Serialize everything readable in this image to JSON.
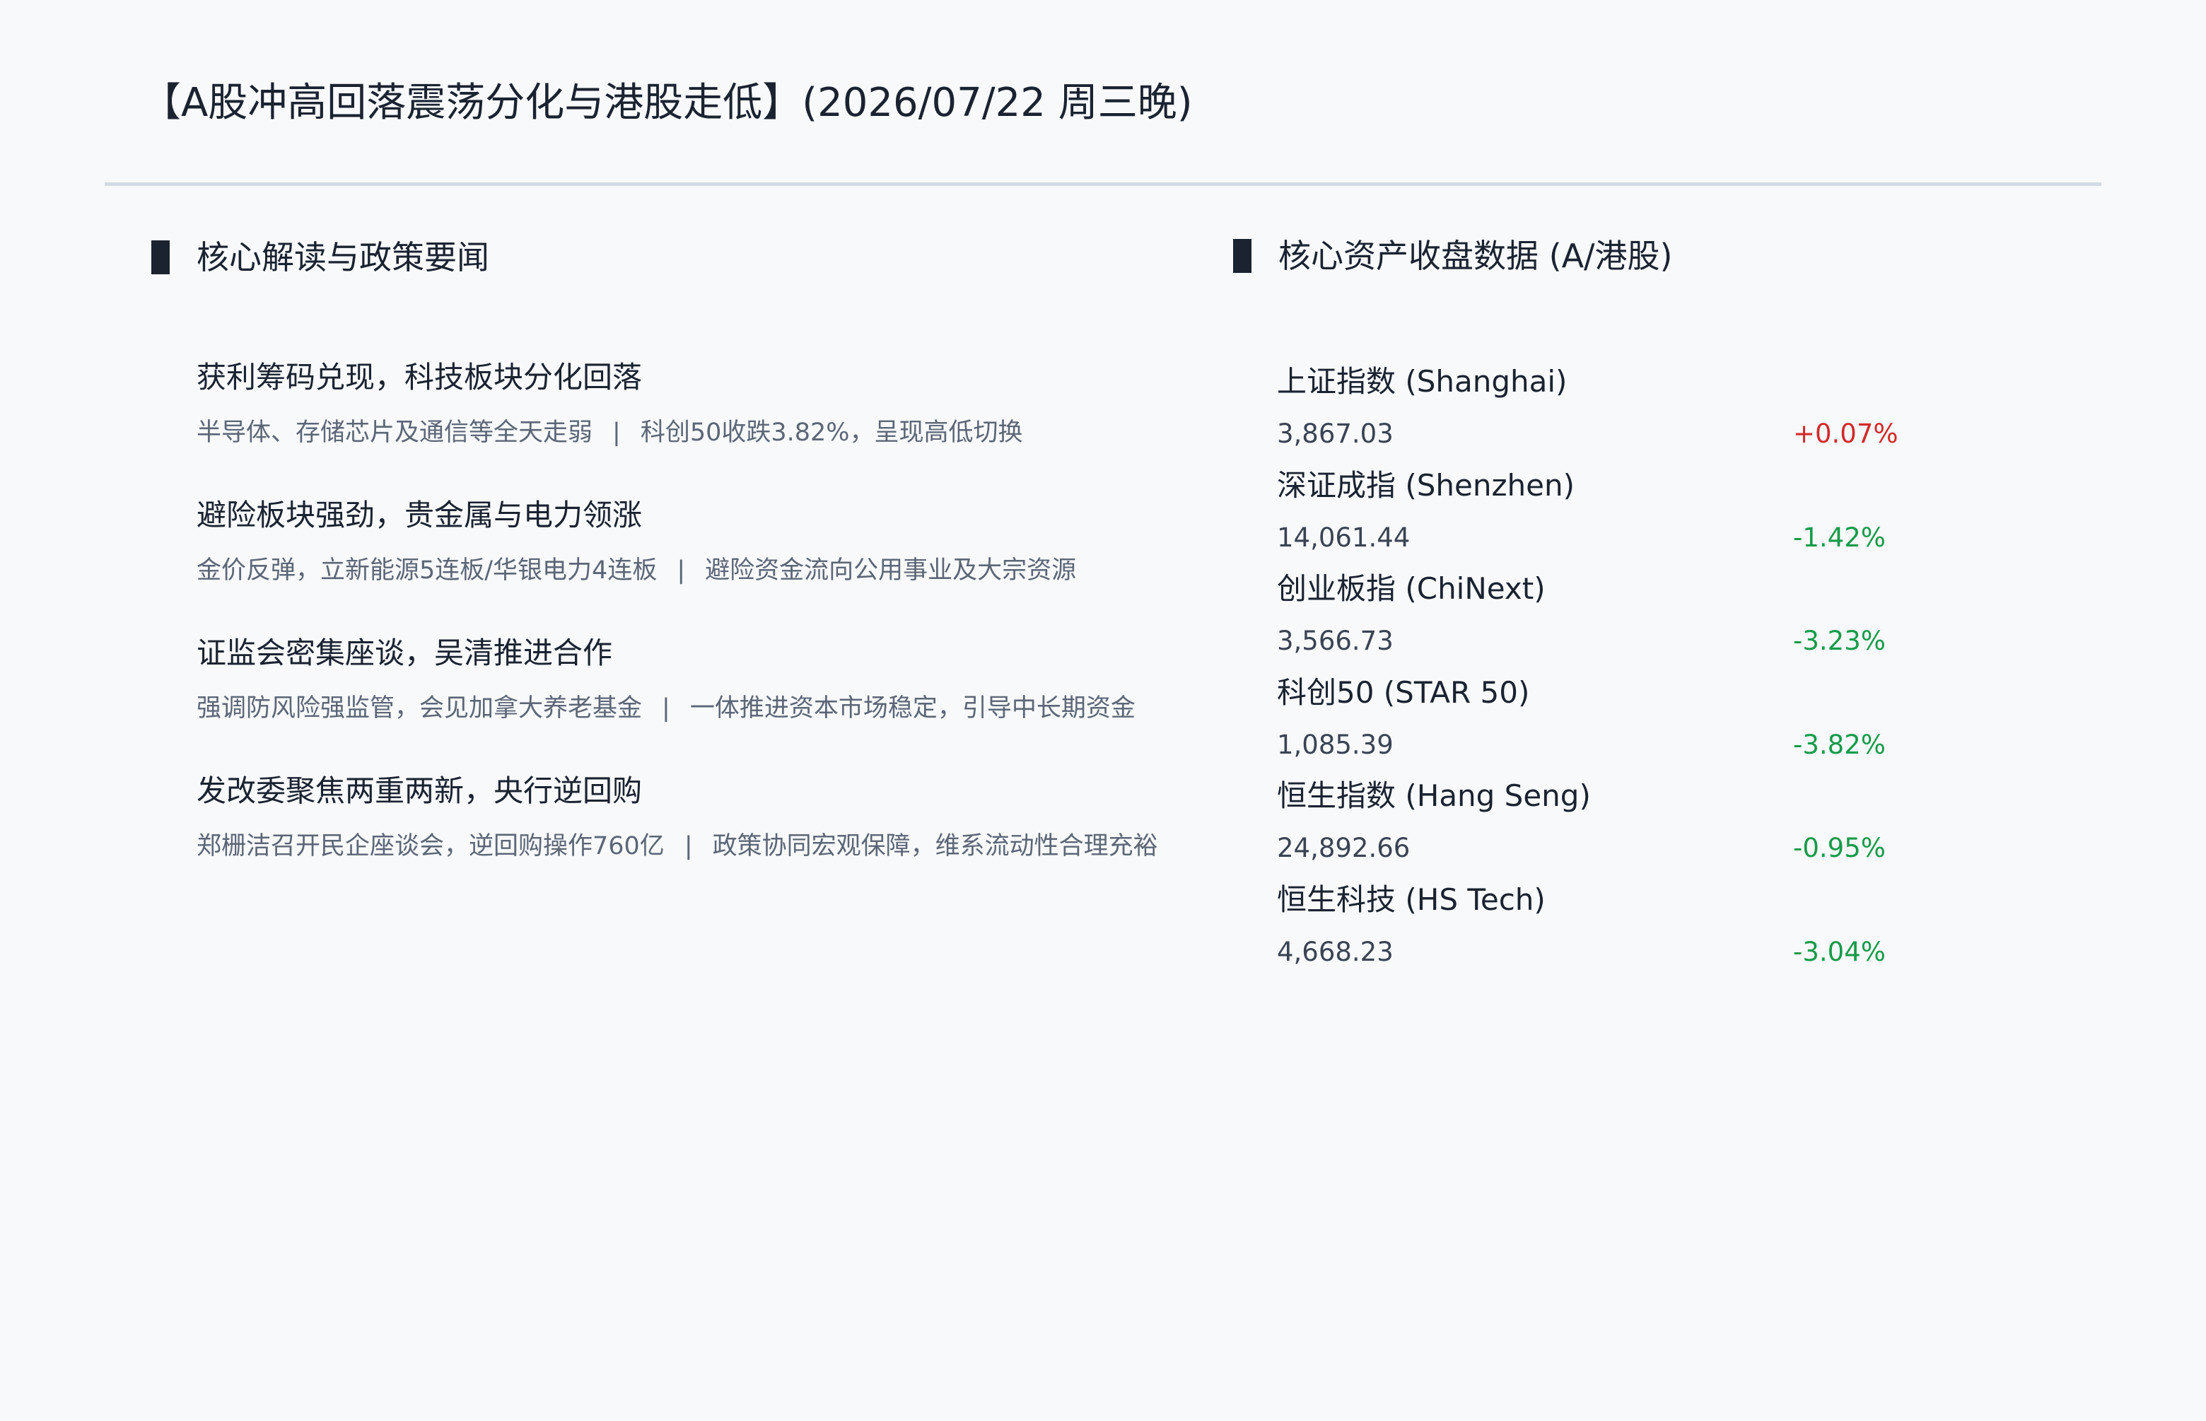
{
  "title": "【A股冲高回落震荡分化与港股走低】(2026/07/22 周三晚)",
  "colors": {
    "up": "#d12b2b",
    "down": "#179a4a",
    "rule": "#d2dbe3",
    "heading_bar": "#1b2230"
  },
  "left_section": {
    "heading": "核心解读与政策要闻",
    "separator": "|",
    "items": [
      {
        "headline": "获利筹码兑现，科技板块分化回落",
        "detail_a": "半导体、存储芯片及通信等全天走弱",
        "detail_b": "科创50收跌3.82%，呈现高低切换"
      },
      {
        "headline": "避险板块强劲，贵金属与电力领涨",
        "detail_a": "金价反弹，立新能源5连板/华银电力4连板",
        "detail_b": "避险资金流向公用事业及大宗资源"
      },
      {
        "headline": "证监会密集座谈，吴清推进合作",
        "detail_a": "强调防风险强监管，会见加拿大养老基金",
        "detail_b": "一体推进资本市场稳定，引导中长期资金"
      },
      {
        "headline": "发改委聚焦两重两新，央行逆回购",
        "detail_a": "郑栅洁召开民企座谈会，逆回购操作760亿",
        "detail_b": "政策协同宏观保障，维系流动性合理充裕"
      }
    ]
  },
  "right_section": {
    "heading": "核心资产收盘数据 (A/港股)",
    "indices": [
      {
        "name": "上证指数 (Shanghai)",
        "close": "3,867.03",
        "change": "+0.07%",
        "direction": "up"
      },
      {
        "name": "深证成指 (Shenzhen)",
        "close": "14,061.44",
        "change": "-1.42%",
        "direction": "down"
      },
      {
        "name": "创业板指 (ChiNext)",
        "close": "3,566.73",
        "change": "-3.23%",
        "direction": "down"
      },
      {
        "name": "科创50 (STAR 50)",
        "close": "1,085.39",
        "change": "-3.82%",
        "direction": "down"
      },
      {
        "name": "恒生指数 (Hang Seng)",
        "close": "24,892.66",
        "change": "-0.95%",
        "direction": "down"
      },
      {
        "name": "恒生科技 (HS Tech)",
        "close": "4,668.23",
        "change": "-3.04%",
        "direction": "down"
      }
    ]
  }
}
